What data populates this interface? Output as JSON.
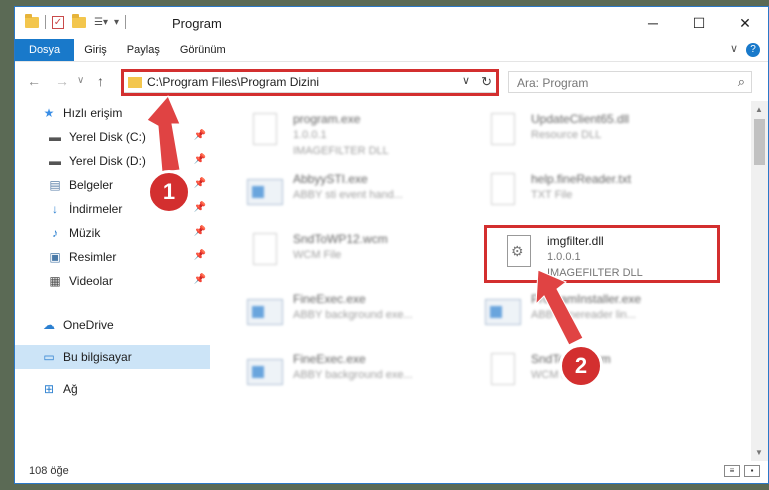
{
  "window": {
    "title": "Program",
    "controls": {
      "minimize": "─",
      "maximize": "☐",
      "close": "✕"
    }
  },
  "ribbon": {
    "tabs": [
      "Dosya",
      "Giriş",
      "Paylaş",
      "Görünüm"
    ],
    "help": "?"
  },
  "address": {
    "path": "C:\\Program Files\\Program Dizini"
  },
  "search": {
    "placeholder": "Ara: Program"
  },
  "sidebar": {
    "items": [
      {
        "label": "Hızlı erişim",
        "icon": "star-icon"
      },
      {
        "label": "Yerel Disk (C:)",
        "icon": "drive-icon"
      },
      {
        "label": "Yerel Disk (D:)",
        "icon": "drive-icon"
      },
      {
        "label": "Belgeler",
        "icon": "documents-icon"
      },
      {
        "label": "İndirmeler",
        "icon": "download-icon"
      },
      {
        "label": "Müzik",
        "icon": "music-icon"
      },
      {
        "label": "Resimler",
        "icon": "pictures-icon"
      },
      {
        "label": "Videolar",
        "icon": "videos-icon"
      },
      {
        "label": "OneDrive",
        "icon": "cloud-icon"
      },
      {
        "label": "Bu bilgisayar",
        "icon": "computer-icon"
      },
      {
        "label": "Ağ",
        "icon": "network-icon"
      }
    ]
  },
  "files": [
    {
      "name": "program.exe",
      "line2": "1.0.0.1",
      "line3": "IMAGEFILTER DLL"
    },
    {
      "name": "UpdateClient65.dll",
      "line2": "Resource DLL",
      "line3": ""
    },
    {
      "name": "AbbyySTI.exe",
      "line2": "ABBY sti event hand...",
      "line3": ""
    },
    {
      "name": "help.fineReader.txt",
      "line2": "TXT File",
      "line3": ""
    },
    {
      "name": "SndToWP12.wcm",
      "line2": "WCM File",
      "line3": ""
    },
    {
      "name": "imgfilter.dll",
      "line2": "1.0.0.1",
      "line3": "IMAGEFILTER DLL"
    },
    {
      "name": "FineExec.exe",
      "line2": "ABBY background exe...",
      "line3": ""
    },
    {
      "name": "ProgramInstaller.exe",
      "line2": "ABBY finereader lin...",
      "line3": ""
    },
    {
      "name": "FineExec.exe",
      "line2": "ABBY background exe...",
      "line3": ""
    },
    {
      "name": "SndToWP.wcm",
      "line2": "WCM File",
      "line3": ""
    }
  ],
  "status": {
    "count": "108 öğe"
  },
  "callouts": [
    "1",
    "2"
  ],
  "colors": {
    "accent": "#1979ca",
    "highlight": "#d32f2f"
  }
}
